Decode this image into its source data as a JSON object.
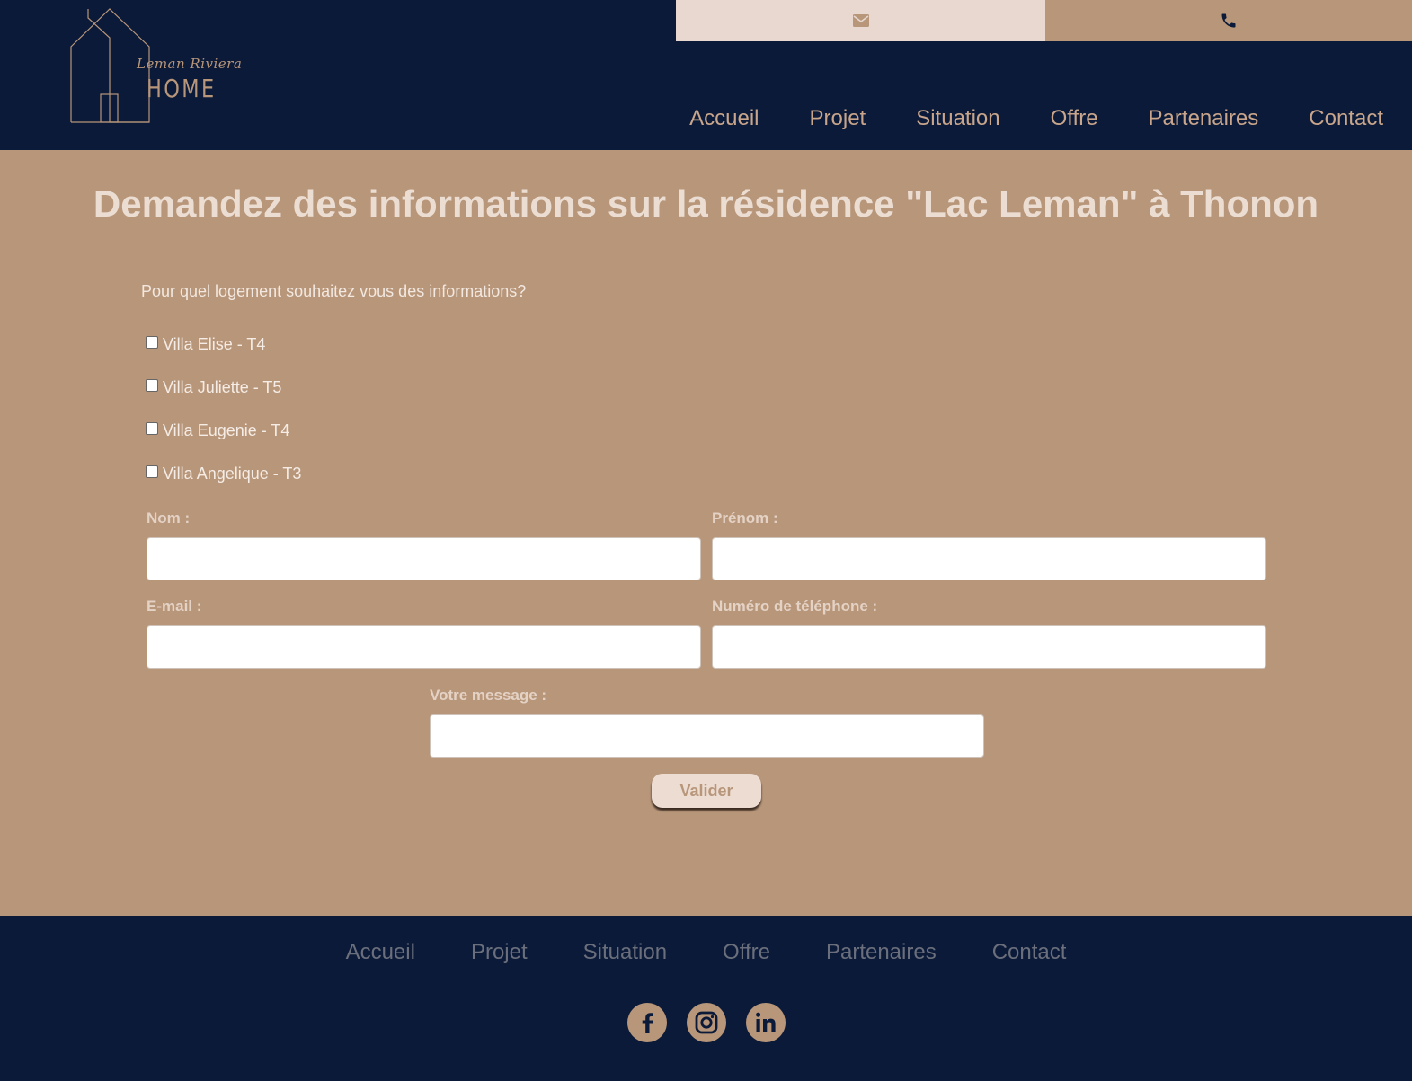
{
  "brand": {
    "script": "Leman Riviera",
    "home": "HOME"
  },
  "topbar": {
    "email_icon": "envelope-icon",
    "phone_icon": "phone-icon"
  },
  "nav": [
    "Accueil",
    "Projet",
    "Situation",
    "Offre",
    "Partenaires",
    "Contact"
  ],
  "main": {
    "title": "Demandez des informations sur la résidence \"Lac Leman\" à Thonon",
    "question": "Pour quel logement souhaitez vous des informations?",
    "options": [
      "Villa Elise - T4",
      "Villa Juliette - T5",
      "Villa Eugenie - T4",
      "Villa Angelique - T3"
    ],
    "fields": {
      "nom": "Nom :",
      "prenom": "Prénom :",
      "email": "E-mail :",
      "telephone": "Numéro de téléphone :",
      "message": "Votre message :"
    },
    "submit": "Valider"
  },
  "footer": {
    "nav": [
      "Accueil",
      "Projet",
      "Situation",
      "Offre",
      "Partenaires",
      "Contact"
    ],
    "socials": [
      "facebook-icon",
      "instagram-icon",
      "linkedin-icon"
    ]
  },
  "colors": {
    "navy": "#0a1a38",
    "tan": "#b8967a",
    "cream": "#e8d8cf"
  }
}
